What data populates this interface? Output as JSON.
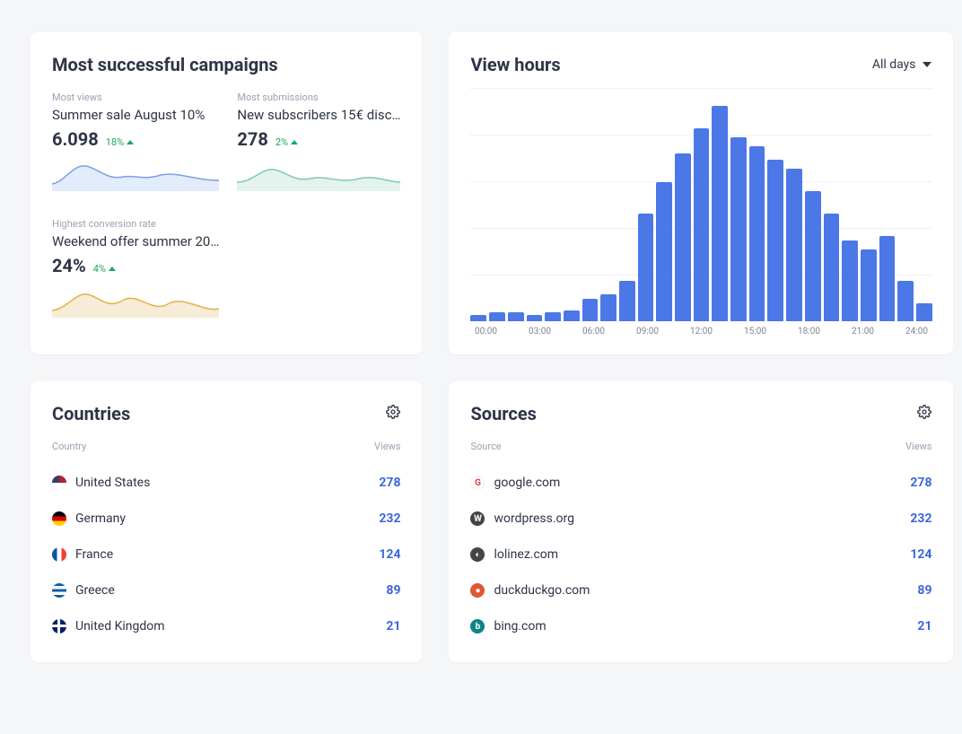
{
  "campaigns": {
    "title": "Most successful campaigns",
    "items": [
      {
        "label": "Most views",
        "name": "Summer sale August 10%",
        "value": "6.098",
        "delta": "18%",
        "color": "#7ea0e6",
        "fill": "#e3ecfb"
      },
      {
        "label": "Most submissions",
        "name": "New subscribers 15€ disc…",
        "value": "278",
        "delta": "2%",
        "color": "#7fc9b1",
        "fill": "#e4f3ee"
      },
      {
        "label": "Highest conversion rate",
        "name": "Weekend offer summer 20…",
        "value": "24%",
        "delta": "4%",
        "color": "#e4b04a",
        "fill": "#f7ecd5"
      }
    ]
  },
  "view_hours": {
    "title": "View hours",
    "filter_label": "All days"
  },
  "chart_data": {
    "type": "bar",
    "categories": [
      "00:00",
      "01:00",
      "02:00",
      "03:00",
      "04:00",
      "05:00",
      "06:00",
      "07:00",
      "08:00",
      "09:00",
      "10:00",
      "11:00",
      "12:00",
      "13:00",
      "14:00",
      "15:00",
      "16:00",
      "17:00",
      "18:00",
      "19:00",
      "20:00",
      "21:00",
      "22:00",
      "23:00",
      "24:00"
    ],
    "values": [
      3,
      4,
      4,
      3,
      4,
      5,
      10,
      12,
      18,
      48,
      62,
      75,
      86,
      96,
      82,
      78,
      72,
      68,
      58,
      48,
      36,
      32,
      38,
      18,
      8
    ],
    "title": "View hours",
    "xlabel": "",
    "ylabel": "",
    "ylim": [
      0,
      100
    ],
    "x_tick_labels": [
      "00:00",
      "03:00",
      "06:00",
      "09:00",
      "12:00",
      "15:00",
      "18:00",
      "21:00",
      "24:00"
    ]
  },
  "countries": {
    "title": "Countries",
    "col1": "Country",
    "col2": "Views",
    "rows": [
      {
        "icon": "flag-us",
        "label": "United States",
        "value": "278"
      },
      {
        "icon": "flag-de",
        "label": "Germany",
        "value": "232"
      },
      {
        "icon": "flag-fr",
        "label": "France",
        "value": "124"
      },
      {
        "icon": "flag-gr",
        "label": "Greece",
        "value": "89"
      },
      {
        "icon": "flag-gb",
        "label": "United Kingdom",
        "value": "21"
      }
    ]
  },
  "sources": {
    "title": "Sources",
    "col1": "Source",
    "col2": "Views",
    "rows": [
      {
        "icon": "src-google",
        "glyph": "G",
        "glyph_color": "#ea4335",
        "label": "google.com",
        "value": "278"
      },
      {
        "icon": "src-wp",
        "glyph": "W",
        "label": "wordpress.org",
        "value": "232"
      },
      {
        "icon": "src-lolinez",
        "glyph": "◐",
        "label": "lolinez.com",
        "value": "124"
      },
      {
        "icon": "src-ddg",
        "glyph": "●",
        "label": "duckduckgo.com",
        "value": "89"
      },
      {
        "icon": "src-bing",
        "glyph": "b",
        "label": "bing.com",
        "value": "21"
      }
    ]
  }
}
